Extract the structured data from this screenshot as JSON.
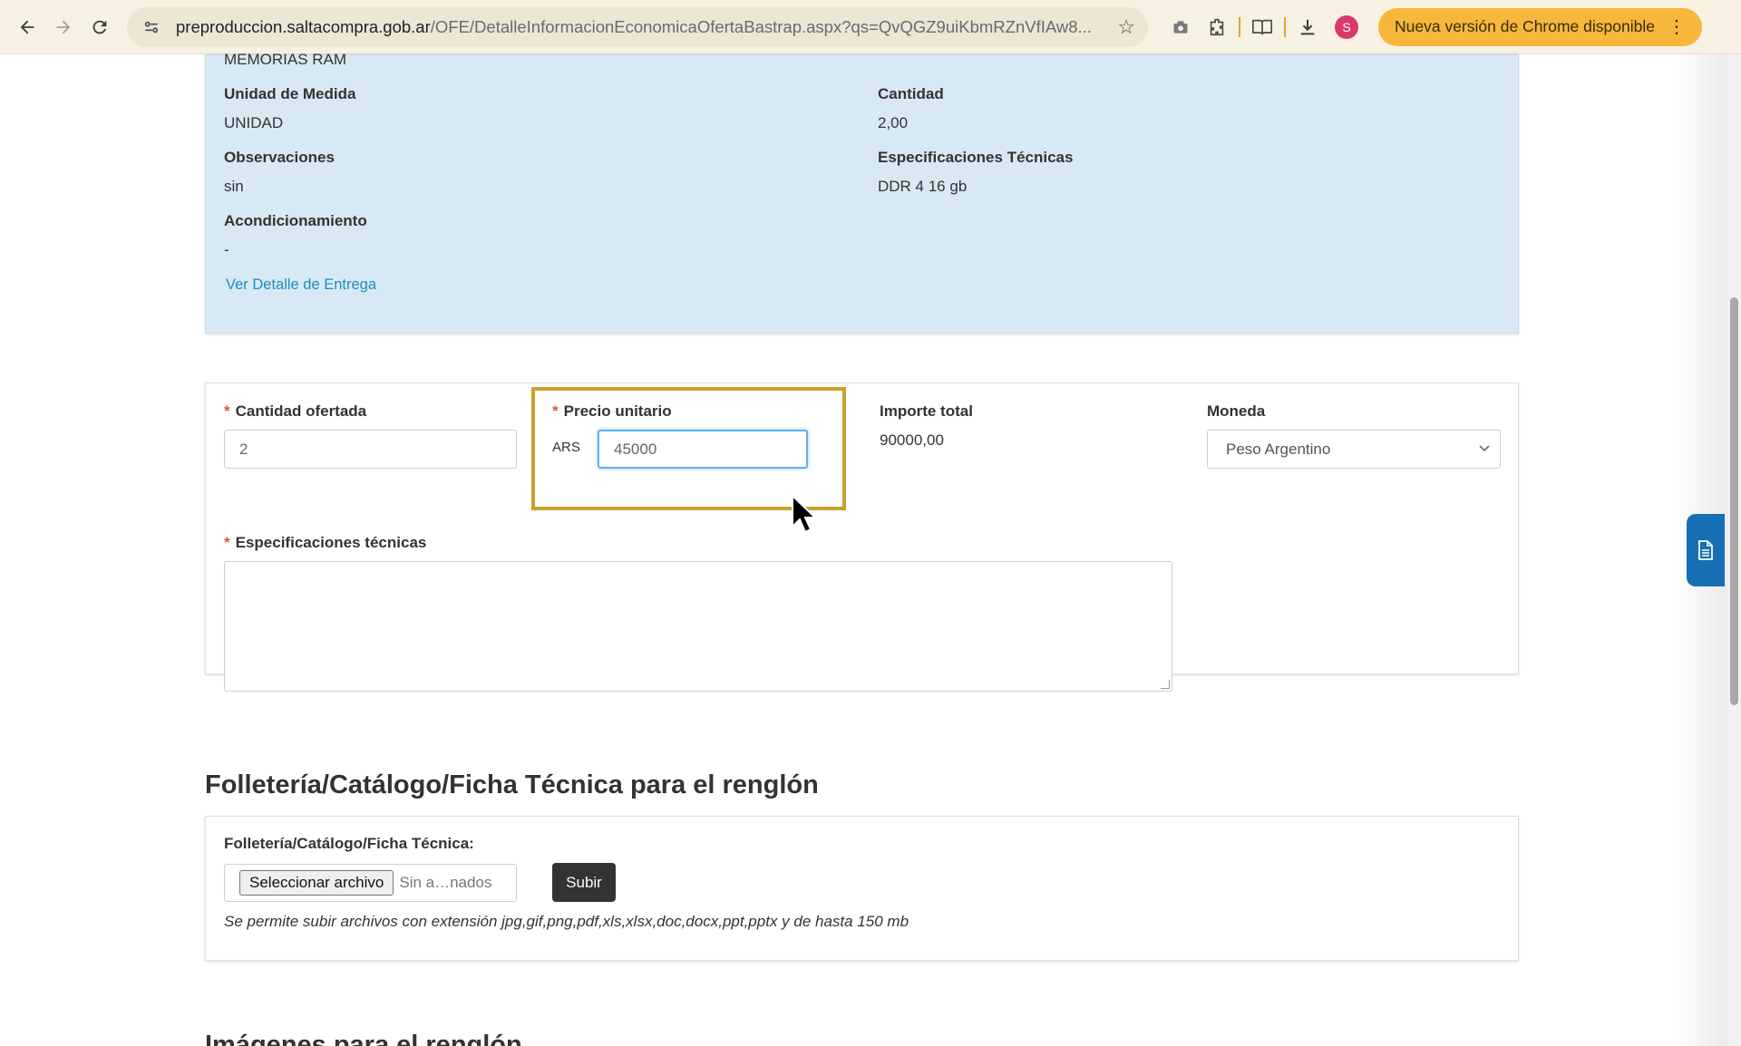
{
  "browser": {
    "url_host": "preproduccion.saltacompra.gob.ar",
    "url_path": "/OFE/DetalleInformacionEconomicaOfertaBastrap.aspx?qs=QvQGZ9uiKbmRZnVfIAw8...",
    "avatar_letter": "S",
    "update_label": "Nueva versión de Chrome disponible"
  },
  "item_info": {
    "product_name_partial": "MEMORIAS RAM",
    "unidad_label": "Unidad de Medida",
    "unidad_value": "UNIDAD",
    "cantidad_label": "Cantidad",
    "cantidad_value": "2,00",
    "observaciones_label": "Observaciones",
    "observaciones_value": "sin",
    "especificaciones_label": "Especificaciones Técnicas",
    "especificaciones_value": "DDR 4 16 gb",
    "acondicionamiento_label": "Acondicionamiento",
    "acondicionamiento_value": "-",
    "detalle_link": "Ver Detalle de Entrega"
  },
  "offer_form": {
    "cantidad_ofertada_label": "Cantidad ofertada",
    "cantidad_ofertada_value": "2",
    "precio_unitario_label": "Precio unitario",
    "currency_prefix": "ARS",
    "precio_unitario_value": "45000",
    "importe_total_label": "Importe total",
    "importe_total_value": "90000,00",
    "moneda_label": "Moneda",
    "moneda_value": "Peso Argentino",
    "especificaciones_tecnicas_label": "Especificaciones técnicas",
    "especificaciones_tecnicas_value": ""
  },
  "folleteria": {
    "section_title": "Folletería/Catálogo/Ficha Técnica para el renglón",
    "field_label": "Folletería/Catálogo/Ficha Técnica:",
    "choose_file_label": "Seleccionar archivo",
    "file_status": "Sin a…nados",
    "upload_label": "Subir",
    "hint": "Se permite subir archivos con extensión jpg,gif,png,pdf,xls,xlsx,doc,docx,ppt,pptx y de hasta 150 mb"
  },
  "imagenes": {
    "section_title": "Imágenes para el renglón"
  },
  "icons": [
    "back-arrow-icon",
    "forward-arrow-icon",
    "reload-icon",
    "site-info-icon",
    "star-icon",
    "screenshot-icon",
    "extensions-icon",
    "reading-list-icon",
    "download-icon",
    "menu-dots-icon",
    "document-icon",
    "chevron-down-icon"
  ],
  "colors": {
    "highlight": "#c8a22a",
    "info_panel_bg": "#d9e9f3",
    "link": "#1b8ec3",
    "float_button": "#1670b3"
  }
}
